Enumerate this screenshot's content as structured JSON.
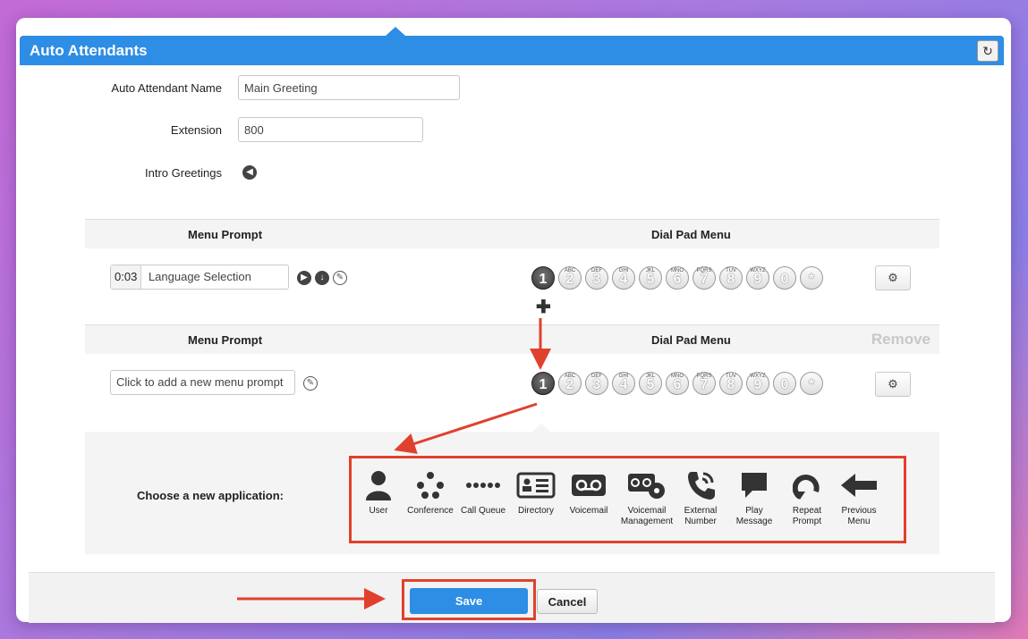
{
  "header": {
    "title": "Auto Attendants",
    "refresh_icon": "refresh-icon"
  },
  "form": {
    "name_label": "Auto Attendant Name",
    "name_value": "Main Greeting",
    "ext_label": "Extension",
    "ext_value": "800",
    "intro_label": "Intro Greetings"
  },
  "menu1": {
    "prompt_header": "Menu Prompt",
    "dial_header": "Dial Pad Menu",
    "time": "0:03",
    "prompt": "Language Selection"
  },
  "menu2": {
    "prompt_header": "Menu Prompt",
    "dial_header": "Dial Pad Menu",
    "remove": "Remove",
    "placeholder": "Click to add a new menu prompt"
  },
  "dialpad": [
    {
      "digit": "1",
      "letters": ""
    },
    {
      "digit": "2",
      "letters": "ABC"
    },
    {
      "digit": "3",
      "letters": "DEF"
    },
    {
      "digit": "4",
      "letters": "GHI"
    },
    {
      "digit": "5",
      "letters": "JKL"
    },
    {
      "digit": "6",
      "letters": "MNO"
    },
    {
      "digit": "7",
      "letters": "PQRS"
    },
    {
      "digit": "8",
      "letters": "TUV"
    },
    {
      "digit": "9",
      "letters": "WXYZ"
    },
    {
      "digit": "0",
      "letters": ""
    },
    {
      "digit": "*",
      "letters": ""
    }
  ],
  "applications": {
    "choose_label": "Choose a new application:",
    "items": [
      {
        "name": "user",
        "line1": "User",
        "line2": ""
      },
      {
        "name": "conference",
        "line1": "Conference",
        "line2": ""
      },
      {
        "name": "call-queue",
        "line1": "Call Queue",
        "line2": ""
      },
      {
        "name": "directory",
        "line1": "Directory",
        "line2": ""
      },
      {
        "name": "voicemail",
        "line1": "Voicemail",
        "line2": ""
      },
      {
        "name": "voicemail-management",
        "line1": "Voicemail",
        "line2": "Management"
      },
      {
        "name": "external-number",
        "line1": "External",
        "line2": "Number"
      },
      {
        "name": "play-message",
        "line1": "Play",
        "line2": "Message"
      },
      {
        "name": "repeat-prompt",
        "line1": "Repeat",
        "line2": "Prompt"
      },
      {
        "name": "previous-menu",
        "line1": "Previous",
        "line2": "Menu"
      }
    ]
  },
  "footer": {
    "save": "Save",
    "cancel": "Cancel"
  },
  "colors": {
    "accent": "#2e8de4",
    "annotation": "#e0412c"
  }
}
